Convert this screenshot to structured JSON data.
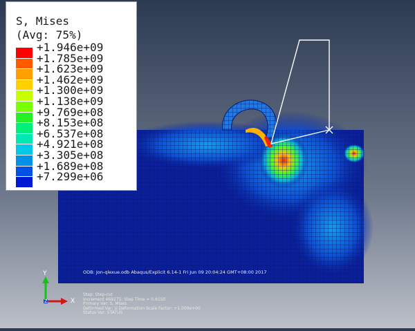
{
  "legend": {
    "title": "S, Mises",
    "subtitle": "(Avg: 75%)",
    "colors": [
      "#ff0000",
      "#ff5a00",
      "#ffa000",
      "#ffd000",
      "#c8ff00",
      "#78ff00",
      "#28f028",
      "#00f07a",
      "#00e8b4",
      "#00c8e6",
      "#0090e6",
      "#0050e6",
      "#0018d2"
    ],
    "labels": [
      "+1.946e+09",
      "+1.785e+09",
      "+1.623e+09",
      "+1.462e+09",
      "+1.300e+09",
      "+1.138e+09",
      "+9.769e+08",
      "+8.153e+08",
      "+6.537e+08",
      "+4.921e+08",
      "+3.305e+08",
      "+1.689e+08",
      "+7.299e+06"
    ]
  },
  "odb_info": "ODB: Jon-qlexue.odb    Abaqus/Explicit 6.14-1    Fri Jun 09 20:04:24 GMT+08:00 2017",
  "status": [
    "Step: Step-cut",
    "Increment    469275: Step Time =    0.6150",
    "Primary Var: S, Mises",
    "Deformed Var: U   Deformation Scale Factor: +1.000e+00",
    "Status Var: STATUS"
  ],
  "triad": {
    "x_label": "X",
    "y_label": "Y",
    "z_label": "Z"
  },
  "colors": {
    "mesh_base": "#0a1e9e",
    "tool_line": "#ffffff",
    "x_axis": "#d01818",
    "y_axis": "#18c018"
  }
}
